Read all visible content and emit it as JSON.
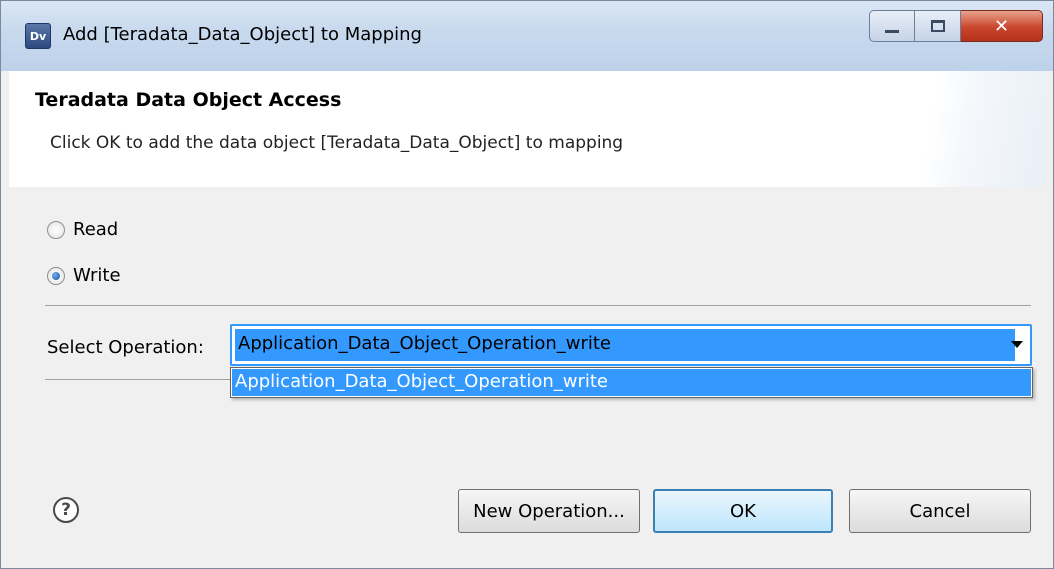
{
  "window": {
    "title": "Add [Teradata_Data_Object] to Mapping",
    "app_icon_text": "Dv"
  },
  "header": {
    "title": "Teradata Data Object Access",
    "description": "Click OK to add the data object [Teradata_Data_Object] to mapping"
  },
  "options": {
    "read_label": "Read",
    "write_label": "Write",
    "selected": "Write"
  },
  "operation": {
    "label": "Select Operation:",
    "selected_value": "Application_Data_Object_Operation_write",
    "dropdown_items": [
      "Application_Data_Object_Operation_write"
    ]
  },
  "buttons": {
    "new_operation": "New Operation...",
    "ok": "OK",
    "cancel": "Cancel"
  },
  "icons": {
    "help": "question-mark-circle-icon"
  }
}
